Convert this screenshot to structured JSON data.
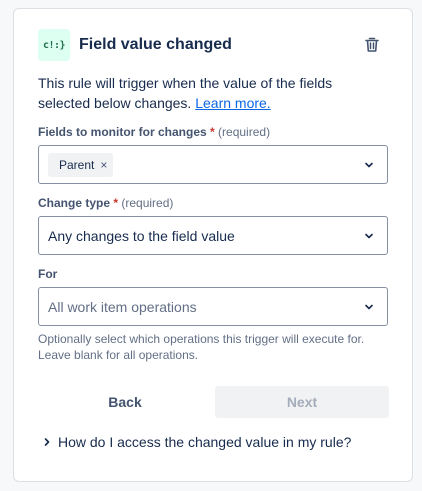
{
  "header": {
    "icon_text": "c!:}",
    "title": "Field value changed",
    "delete_icon": "trash-icon"
  },
  "description": {
    "text": "This rule will trigger when the value of the fields selected below changes. ",
    "link": "Learn more."
  },
  "fields_to_monitor": {
    "label": "Fields to monitor for changes",
    "required_star": "*",
    "required_text": "(required)",
    "selected_tags": [
      "Parent"
    ],
    "remove_glyph": "×"
  },
  "change_type": {
    "label": "Change type",
    "required_star": "*",
    "required_text": "(required)",
    "value": "Any changes to the field value"
  },
  "for_field": {
    "label": "For",
    "placeholder": "All work item operations",
    "helper": "Optionally select which operations this trigger will execute for. Leave blank for all operations."
  },
  "actions": {
    "back": "Back",
    "next": "Next"
  },
  "expander": {
    "label": "How do I access the changed value in my rule?"
  },
  "colors": {
    "link": "#0c66e4",
    "required": "#c9372c",
    "icon_bg": "#dcfff1",
    "icon_fg": "#216e4e"
  }
}
